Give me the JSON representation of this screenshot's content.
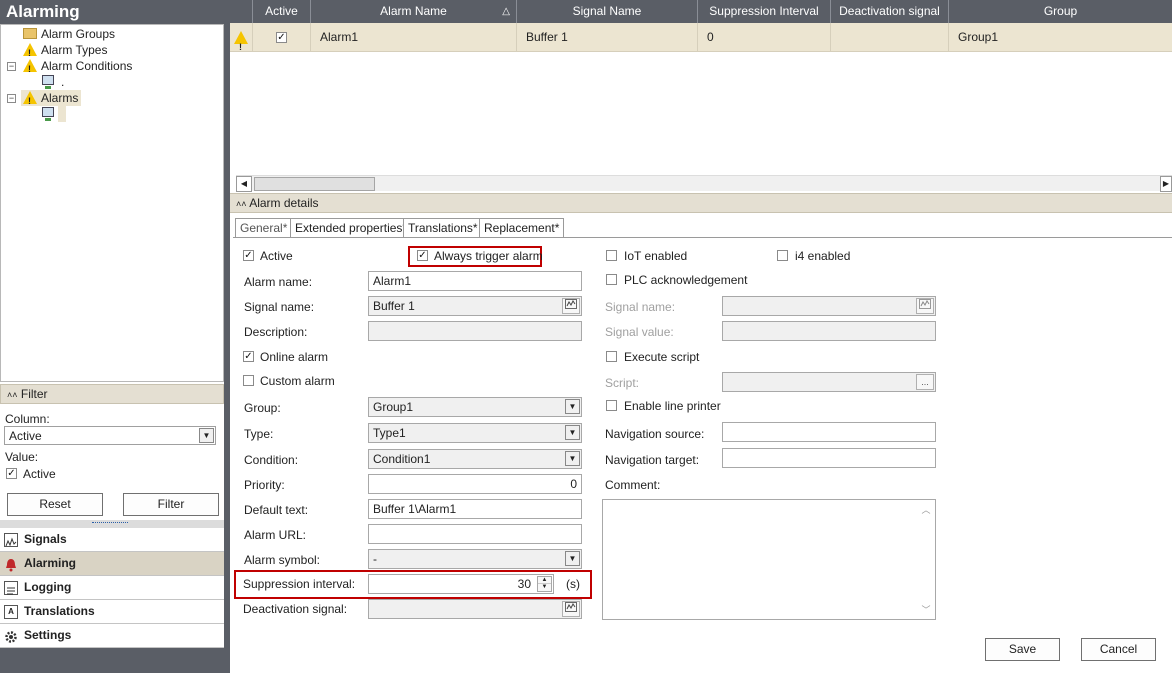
{
  "left": {
    "title": "Alarming",
    "tree": [
      {
        "label": "Alarm Groups"
      },
      {
        "label": "Alarm Types"
      },
      {
        "label": "Alarm Conditions"
      },
      {
        "label": "."
      },
      {
        "label": "Alarms"
      }
    ],
    "filter": {
      "header": "Filter",
      "column_label": "Column:",
      "column_value": "Active",
      "value_label": "Value:",
      "value_checkbox_label": "Active",
      "reset": "Reset",
      "filter": "Filter"
    },
    "nav": [
      {
        "label": "Signals"
      },
      {
        "label": "Alarming"
      },
      {
        "label": "Logging"
      },
      {
        "label": "Translations"
      },
      {
        "label": "Settings"
      }
    ]
  },
  "grid": {
    "headers": [
      "Active",
      "Alarm Name",
      "Signal Name",
      "Suppression Interval",
      "Deactivation signal",
      "Group"
    ],
    "sort_indicator": "△",
    "rows": [
      {
        "alarm_name": "Alarm1",
        "signal_name": "Buffer 1",
        "suppression_interval": "0",
        "deactivation_signal": "",
        "group": "Group1"
      }
    ]
  },
  "details": {
    "header": "Alarm details",
    "tabs": [
      "General*",
      "Extended properties*",
      "Translations*",
      "Replacement*"
    ],
    "left": {
      "active": "Active",
      "always_trigger": "Always trigger alarm",
      "alarm_name_label": "Alarm name:",
      "alarm_name": "Alarm1",
      "signal_name_label": "Signal name:",
      "signal_name": "Buffer 1",
      "description_label": "Description:",
      "description": "",
      "online_alarm": "Online alarm",
      "custom_alarm": "Custom alarm",
      "group_label": "Group:",
      "group": "Group1",
      "type_label": "Type:",
      "type": "Type1",
      "condition_label": "Condition:",
      "condition": "Condition1",
      "priority_label": "Priority:",
      "priority": "0",
      "default_text_label": "Default text:",
      "default_text": "Buffer 1\\Alarm1",
      "alarm_url_label": "Alarm URL:",
      "alarm_url": "",
      "alarm_symbol_label": "Alarm symbol:",
      "alarm_symbol": "-",
      "suppression_label": "Suppression interval:",
      "suppression": "30",
      "suppression_unit": "(s)",
      "deactivation_label": "Deactivation signal:"
    },
    "right": {
      "iot": "IoT enabled",
      "i4": "i4 enabled",
      "plc_ack": "PLC acknowledgement",
      "signal_name_label": "Signal name:",
      "signal_value_label": "Signal value:",
      "execute_script": "Execute script",
      "script_label": "Script:",
      "script_btn": "...",
      "line_printer": "Enable line printer",
      "nav_source_label": "Navigation source:",
      "nav_target_label": "Navigation target:",
      "comment_label": "Comment:"
    },
    "save": "Save",
    "cancel": "Cancel"
  },
  "colors": {
    "dark_bar": "#5a5e66",
    "selected_row": "#ece5d1",
    "highlight_box": "#c00000",
    "warning": "#f5c400"
  }
}
